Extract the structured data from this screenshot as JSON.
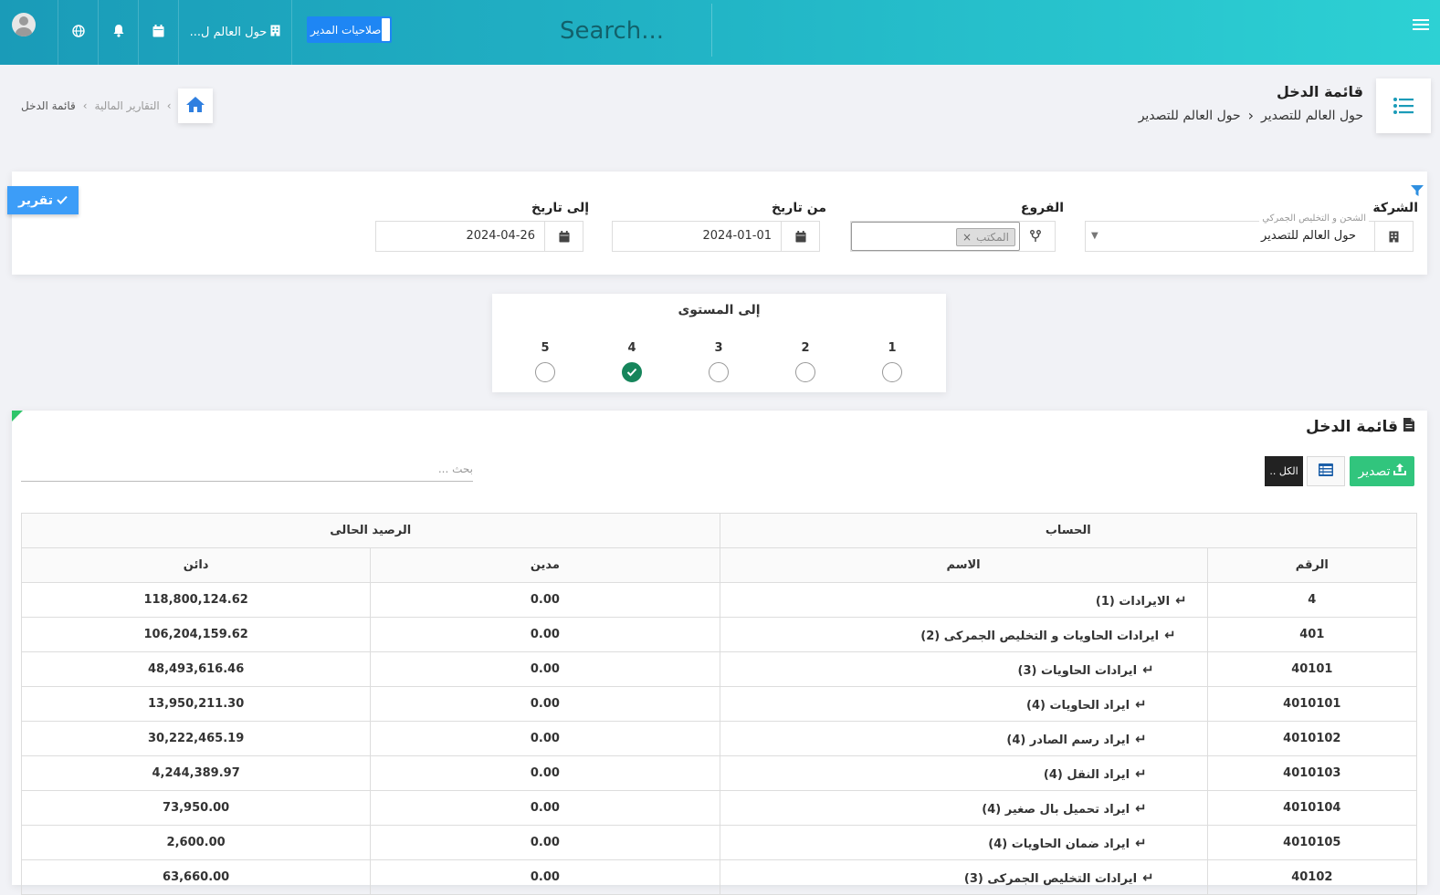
{
  "topbar": {
    "search_placeholder": "Search...",
    "company_short": "حول العالم ل...",
    "admin_permissions": "صلاحيات المدير"
  },
  "header": {
    "title": "قائمة الدخل",
    "sub1": "حول العالم للتصدير",
    "sub2": "حول العالم للتصدير"
  },
  "breadcrumb": {
    "parent": "التقارير المالية",
    "current": "قائمة الدخل"
  },
  "filters": {
    "company_label": "الشركة",
    "company_hint": "الشحن و التخليص الجمركي",
    "company_value": "حول العالم للتصدير",
    "branches_label": "الفروع",
    "branch_tag": "المكتب",
    "from_label": "من تاريخ",
    "from_value": "2024-01-01",
    "to_label": "إلى تاريخ",
    "to_value": "2024-04-26",
    "report_btn": "تقرير"
  },
  "level": {
    "title": "إلى المستوى",
    "options": [
      "1",
      "2",
      "3",
      "4",
      "5"
    ],
    "selected": "4"
  },
  "table_card": {
    "title": "قائمة الدخل",
    "export_btn": "تصدير",
    "all_btn": "الكل ..",
    "search_placeholder": "بحث ..."
  },
  "table": {
    "group_account": "الحساب",
    "group_balance": "الرصيد الحالى",
    "col_number": "الرقم",
    "col_name": "الاسم",
    "col_debit": "مدين",
    "col_credit": "دائن",
    "rows": [
      {
        "number": "4",
        "name": "الايرادات (1)",
        "debit": "0.00",
        "credit": "118,800,124.62"
      },
      {
        "number": "401",
        "name": "ايرادات الحاويات و التخليص الجمركى (2)",
        "debit": "0.00",
        "credit": "106,204,159.62"
      },
      {
        "number": "40101",
        "name": "ايرادات الحاويات (3)",
        "debit": "0.00",
        "credit": "48,493,616.46"
      },
      {
        "number": "4010101",
        "name": "ايراد الحاويات (4)",
        "debit": "0.00",
        "credit": "13,950,211.30"
      },
      {
        "number": "4010102",
        "name": "ايراد رسم الصادر (4)",
        "debit": "0.00",
        "credit": "30,222,465.19"
      },
      {
        "number": "4010103",
        "name": "ايراد النقل (4)",
        "debit": "0.00",
        "credit": "4,244,389.97"
      },
      {
        "number": "4010104",
        "name": "ايراد تحميل بال صغير (4)",
        "debit": "0.00",
        "credit": "73,950.00"
      },
      {
        "number": "4010105",
        "name": "ايراد ضمان الحاويات (4)",
        "debit": "0.00",
        "credit": "2,600.00"
      },
      {
        "number": "40102",
        "name": "ايرادات التخليص الجمركى (3)",
        "debit": "0.00",
        "credit": "63,660.00"
      }
    ]
  },
  "colors": {
    "topbar_start": "#1a9bb8",
    "topbar_end": "#2dd1d4",
    "primary_blue": "#3c9df8",
    "export_green": "#31c57d",
    "radio_checked": "#16855b"
  }
}
